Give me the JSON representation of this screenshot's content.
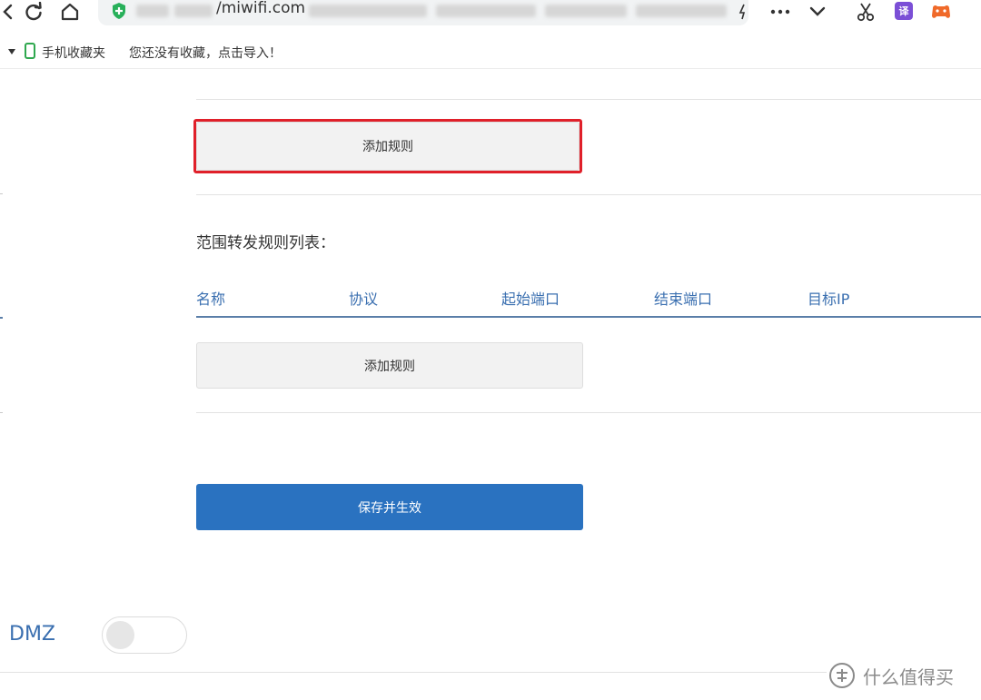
{
  "browser": {
    "url": "/miwifi.com",
    "extensions": {
      "translate_icon_text": "译",
      "translate_color": "#7b4fd6",
      "game_color": "#f06a2a"
    }
  },
  "bookmarks": {
    "folder_label": "手机收藏夹",
    "empty_message": "您还没有收藏，点击导入！"
  },
  "page": {
    "add_rule_top": "添加规则",
    "range_section_title": "范围转发规则列表：",
    "table_headers": [
      "名称",
      "协议",
      "起始端口",
      "结束端口",
      "目标IP"
    ],
    "add_rule_range": "添加规则",
    "save_button": "保存并生效",
    "dmz_label": "DMZ",
    "dmz_enabled": false
  },
  "colors": {
    "accent": "#2a72c0",
    "header_text": "#3a6fb0",
    "highlight": "#e0202a"
  },
  "watermark": {
    "text": "什么值得买"
  }
}
